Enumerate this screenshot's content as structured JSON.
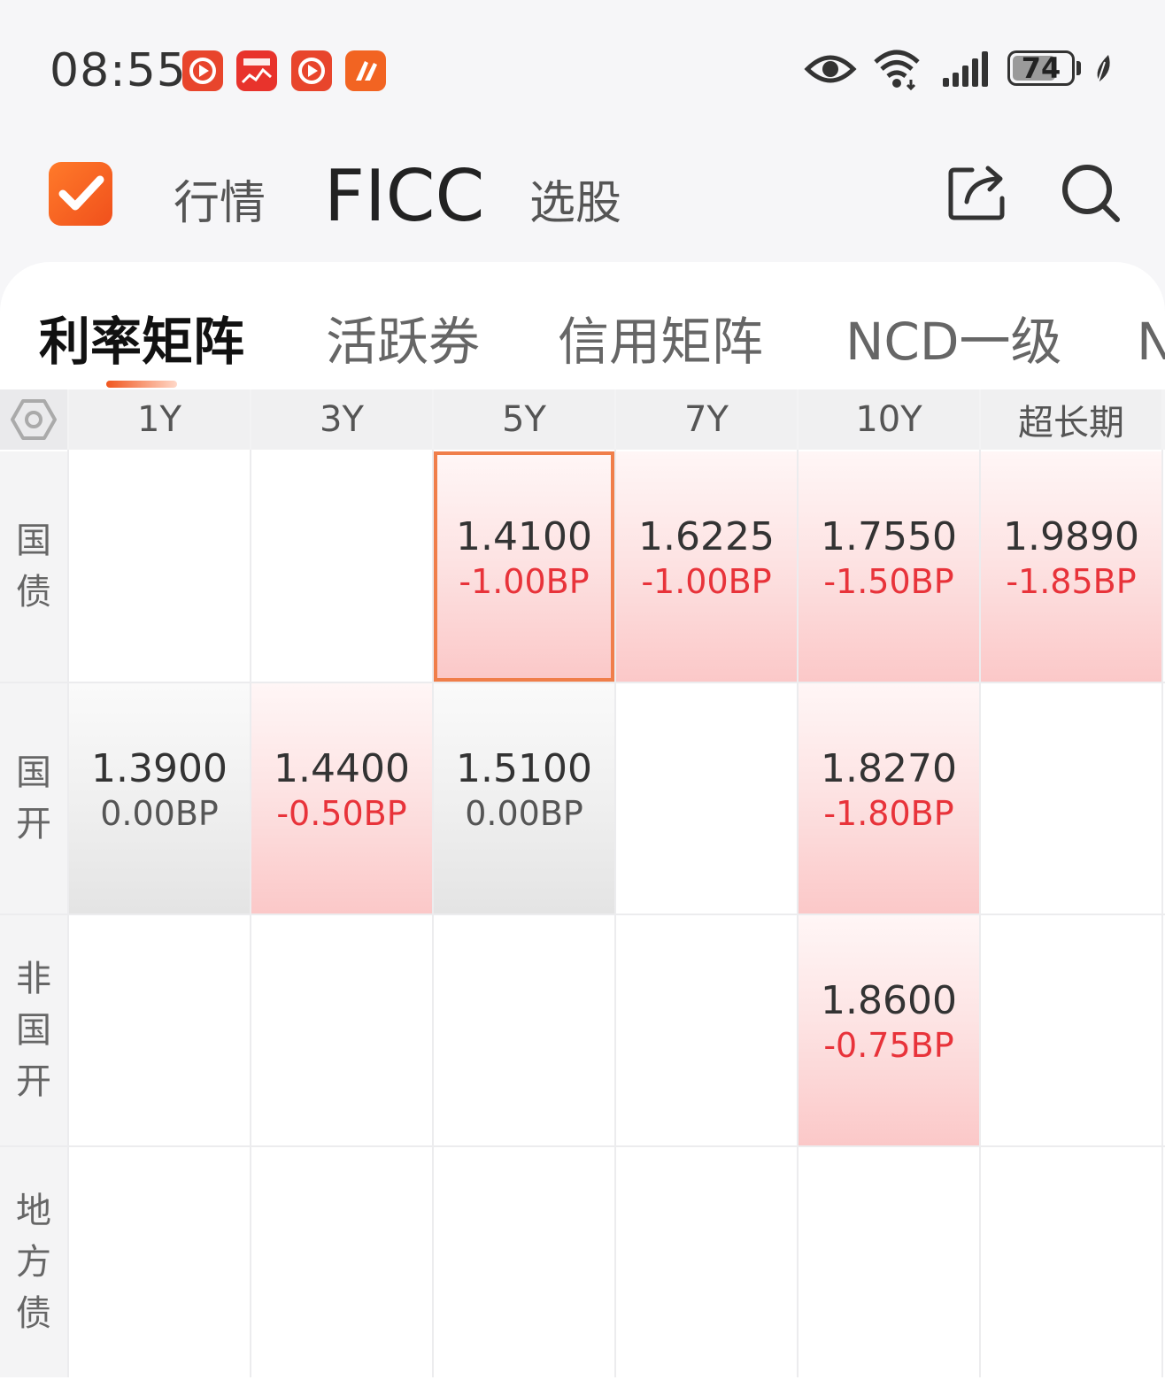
{
  "status_bar": {
    "time": "08:55",
    "battery": "74",
    "notification_apps": [
      "app-notification-icon",
      "app-notification-icon",
      "app-notification-icon",
      "app-notification-icon"
    ]
  },
  "header": {
    "nav": {
      "market": "行情",
      "ficc": "FICC",
      "stock_picker": "选股"
    }
  },
  "sub_tabs": [
    {
      "label": "利率矩阵",
      "active": true
    },
    {
      "label": "活跃券",
      "active": false
    },
    {
      "label": "信用矩阵",
      "active": false
    },
    {
      "label": "NCD一级",
      "active": false
    },
    {
      "label": "N",
      "active": false
    }
  ],
  "matrix": {
    "columns": [
      "1Y",
      "3Y",
      "5Y",
      "7Y",
      "10Y",
      "超长期"
    ],
    "rows": [
      {
        "label": "国债",
        "cells": [
          null,
          null,
          {
            "yield": "1.4100",
            "change": "-1.00BP",
            "tone": "red",
            "selected": true
          },
          {
            "yield": "1.6225",
            "change": "-1.00BP",
            "tone": "red"
          },
          {
            "yield": "1.7550",
            "change": "-1.50BP",
            "tone": "red"
          },
          {
            "yield": "1.9890",
            "change": "-1.85BP",
            "tone": "red"
          }
        ]
      },
      {
        "label": "国开",
        "cells": [
          {
            "yield": "1.3900",
            "change": "0.00BP",
            "tone": "gray"
          },
          {
            "yield": "1.4400",
            "change": "-0.50BP",
            "tone": "red"
          },
          {
            "yield": "1.5100",
            "change": "0.00BP",
            "tone": "gray"
          },
          null,
          {
            "yield": "1.8270",
            "change": "-1.80BP",
            "tone": "red"
          },
          null
        ]
      },
      {
        "label": "非国开",
        "cells": [
          null,
          null,
          null,
          null,
          {
            "yield": "1.8600",
            "change": "-0.75BP",
            "tone": "red"
          },
          null
        ]
      },
      {
        "label": "地方债",
        "cells": [
          null,
          null,
          null,
          null,
          null,
          null
        ]
      }
    ]
  },
  "colors": {
    "accent": "#f0561e",
    "down": "#e8333a",
    "neutral": "#555555"
  }
}
